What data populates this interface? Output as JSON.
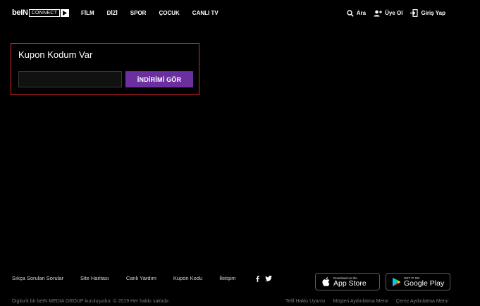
{
  "header": {
    "logo": {
      "bein": "beIN",
      "connect": "CONNECT"
    },
    "nav": [
      {
        "label": "FİLM"
      },
      {
        "label": "DİZİ"
      },
      {
        "label": "SPOR"
      },
      {
        "label": "ÇOCUK"
      },
      {
        "label": "CANLI TV"
      }
    ],
    "search_label": "Ara",
    "signup_label": "Üye Ol",
    "login_label": "Giriş Yap"
  },
  "coupon": {
    "title": "Kupon Kodum Var",
    "input_value": "",
    "button_label": "İNDİRİMİ GÖR",
    "border_color": "#e0262b",
    "button_color": "#6b2fa0"
  },
  "footer": {
    "links": [
      {
        "label": "Sıkça Sorulan Sorular"
      },
      {
        "label": "Site Haritası"
      },
      {
        "label": "Canlı Yardım"
      },
      {
        "label": "Kupon Kodu"
      },
      {
        "label": "İletişim"
      }
    ],
    "social": [
      "facebook-icon",
      "twitter-icon"
    ],
    "app_store": {
      "small": "Download on the",
      "big": "App Store"
    },
    "google_play": {
      "small": "GET IT ON",
      "big": "Google Play"
    },
    "copyright": "Digiturk bir beIN MEDIA GROUP kuruluşudur. © 2019 Her hakkı saklıdır.",
    "legal": [
      {
        "label": "Telif Hakkı Uyarısı"
      },
      {
        "label": "Müşteri Aydınlatma Metni"
      },
      {
        "label": "Çerez Aydınlatma Metni"
      }
    ]
  }
}
